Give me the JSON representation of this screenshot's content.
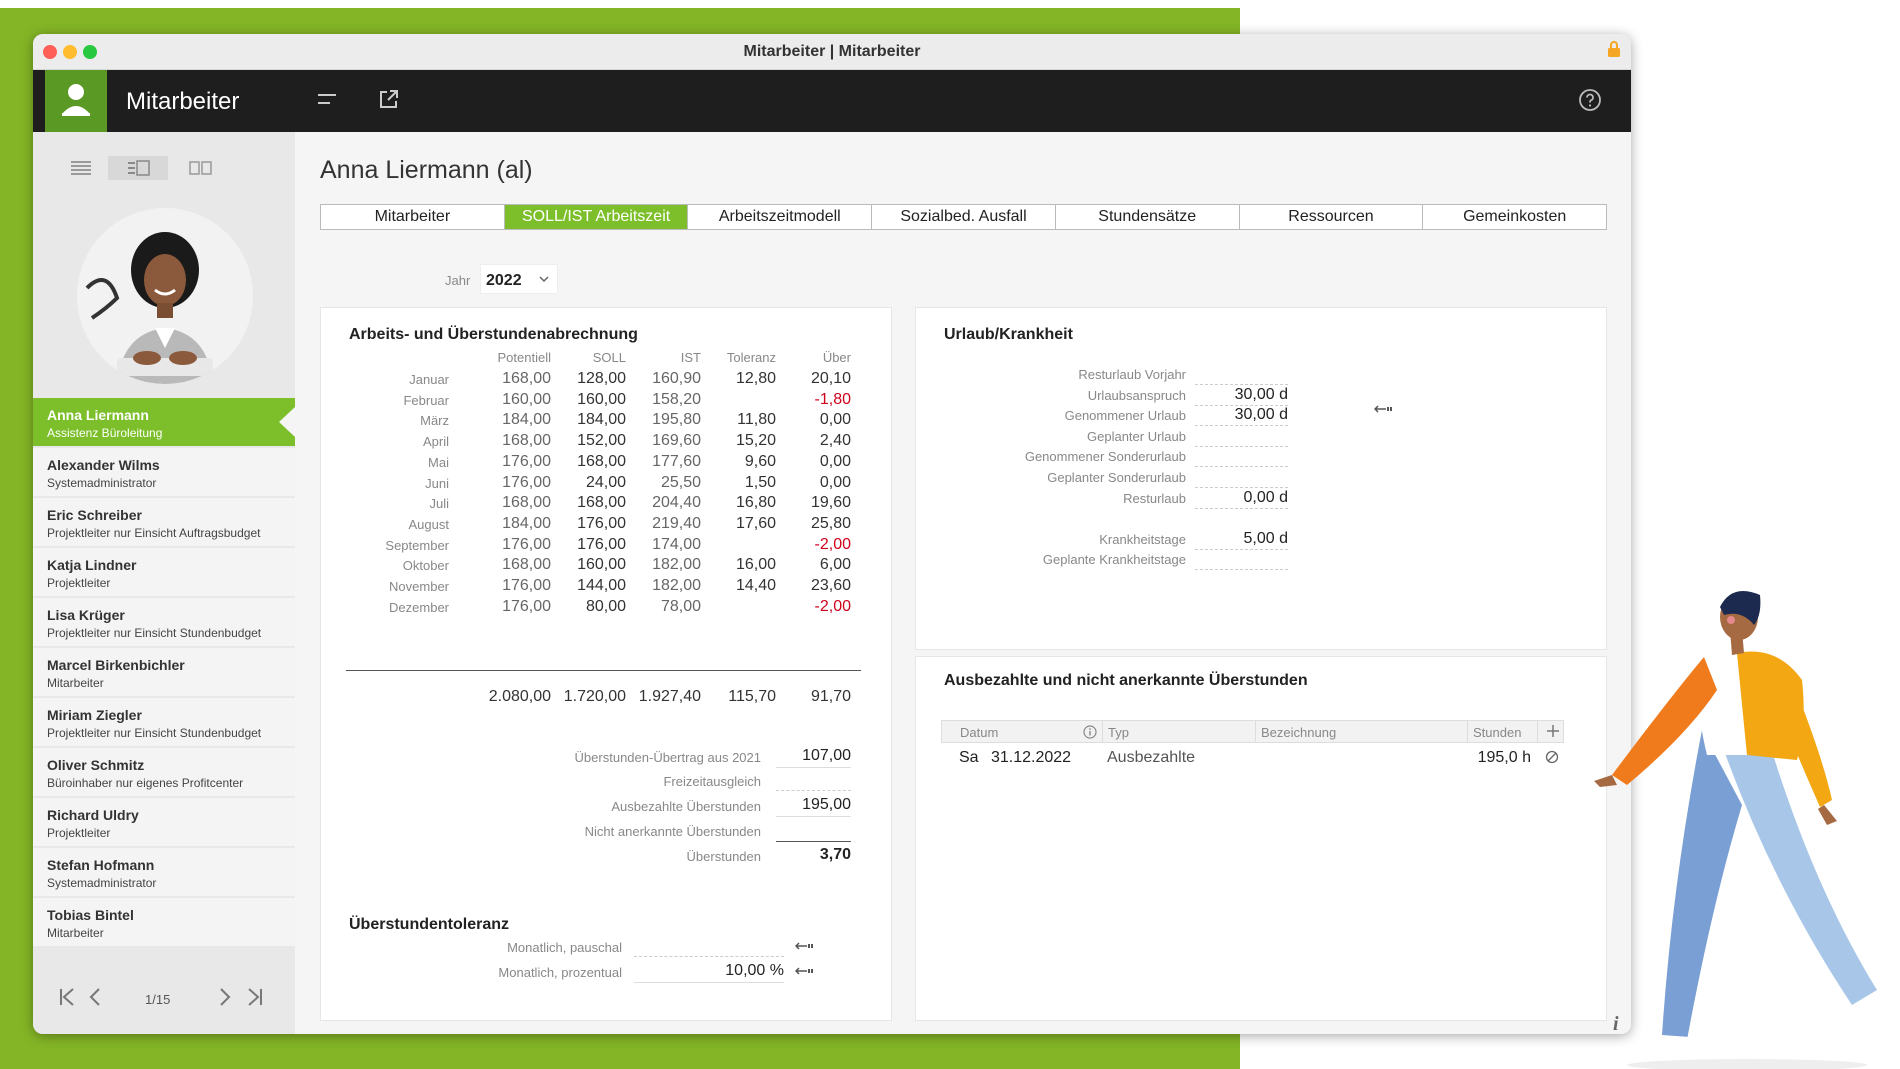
{
  "window": {
    "title": "Mitarbeiter | Mitarbeiter"
  },
  "app": {
    "name": "Mitarbeiter"
  },
  "sidebar": {
    "employees": [
      {
        "name": "Anna Liermann",
        "role": "Assistenz Büroleitung"
      },
      {
        "name": "Alexander Wilms",
        "role": "Systemadministrator"
      },
      {
        "name": "Eric Schreiber",
        "role": "Projektleiter nur Einsicht Auftragsbudget"
      },
      {
        "name": "Katja Lindner",
        "role": "Projektleiter"
      },
      {
        "name": "Lisa Krüger",
        "role": "Projektleiter nur Einsicht Stundenbudget"
      },
      {
        "name": "Marcel Birkenbichler",
        "role": "Mitarbeiter"
      },
      {
        "name": "Miriam Ziegler",
        "role": "Projektleiter nur Einsicht Stundenbudget"
      },
      {
        "name": "Oliver Schmitz",
        "role": "Büroinhaber nur eigenes Profitcenter"
      },
      {
        "name": "Richard Uldry",
        "role": "Projektleiter"
      },
      {
        "name": "Stefan Hofmann",
        "role": "Systemadministrator"
      },
      {
        "name": "Tobias Bintel",
        "role": "Mitarbeiter"
      }
    ],
    "pager": "1/15"
  },
  "main": {
    "title": "Anna Liermann (al)",
    "tabs": [
      "Mitarbeiter",
      "SOLL/IST Arbeitszeit",
      "Arbeitszeitmodell",
      "Sozialbed. Ausfall",
      "Stundensätze",
      "Ressourcen",
      "Gemeinkosten"
    ],
    "year_label": "Jahr",
    "year": "2022"
  },
  "hours": {
    "title": "Arbeits- und Überstundenabrechnung",
    "headers": [
      "Potentiell",
      "SOLL",
      "IST",
      "Toleranz",
      "Über"
    ],
    "rows": [
      {
        "month": "Januar",
        "pot": "168,00",
        "soll": "128,00",
        "ist": "160,90",
        "tol": "12,80",
        "uber": "20,10"
      },
      {
        "month": "Februar",
        "pot": "160,00",
        "soll": "160,00",
        "ist": "158,20",
        "tol": "",
        "uber": "-1,80"
      },
      {
        "month": "März",
        "pot": "184,00",
        "soll": "184,00",
        "ist": "195,80",
        "tol": "11,80",
        "uber": "0,00"
      },
      {
        "month": "April",
        "pot": "168,00",
        "soll": "152,00",
        "ist": "169,60",
        "tol": "15,20",
        "uber": "2,40"
      },
      {
        "month": "Mai",
        "pot": "176,00",
        "soll": "168,00",
        "ist": "177,60",
        "tol": "9,60",
        "uber": "0,00"
      },
      {
        "month": "Juni",
        "pot": "176,00",
        "soll": "24,00",
        "ist": "25,50",
        "tol": "1,50",
        "uber": "0,00"
      },
      {
        "month": "Juli",
        "pot": "168,00",
        "soll": "168,00",
        "ist": "204,40",
        "tol": "16,80",
        "uber": "19,60"
      },
      {
        "month": "August",
        "pot": "184,00",
        "soll": "176,00",
        "ist": "219,40",
        "tol": "17,60",
        "uber": "25,80"
      },
      {
        "month": "September",
        "pot": "176,00",
        "soll": "176,00",
        "ist": "174,00",
        "tol": "",
        "uber": "-2,00"
      },
      {
        "month": "Oktober",
        "pot": "168,00",
        "soll": "160,00",
        "ist": "182,00",
        "tol": "16,00",
        "uber": "6,00"
      },
      {
        "month": "November",
        "pot": "176,00",
        "soll": "144,00",
        "ist": "182,00",
        "tol": "14,40",
        "uber": "23,60"
      },
      {
        "month": "Dezember",
        "pot": "176,00",
        "soll": "80,00",
        "ist": "78,00",
        "tol": "",
        "uber": "-2,00"
      }
    ],
    "totals": {
      "pot": "2.080,00",
      "soll": "1.720,00",
      "ist": "1.927,40",
      "tol": "115,70",
      "uber": "91,70"
    },
    "summary": [
      {
        "label": "Überstunden-Übertrag aus 2021",
        "value": "107,00"
      },
      {
        "label": "Freizeitausgleich",
        "value": ""
      },
      {
        "label": "Ausbezahlte Überstunden",
        "value": "195,00"
      },
      {
        "label": "Nicht anerkannte Überstunden",
        "value": ""
      },
      {
        "label": "Überstunden",
        "value": "3,70"
      }
    ]
  },
  "tolerance": {
    "title": "Überstundentoleranz",
    "flat_label": "Monatlich, pauschal",
    "flat_value": "",
    "pct_label": "Monatlich, prozentual",
    "pct_value": "10,00 %"
  },
  "vacation": {
    "title": "Urlaub/Krankheit",
    "rows": [
      {
        "label": "Resturlaub Vorjahr",
        "value": ""
      },
      {
        "label": "Urlaubsanspruch",
        "value": "30,00 d"
      },
      {
        "label": "Genommener Urlaub",
        "value": "30,00 d"
      },
      {
        "label": "Geplanter Urlaub",
        "value": ""
      },
      {
        "label": "Genommener Sonderurlaub",
        "value": ""
      },
      {
        "label": "Geplanter Sonderurlaub",
        "value": ""
      },
      {
        "label": "Resturlaub",
        "value": "0,00 d"
      },
      {
        "label": "Krankheitstage",
        "value": "5,00 d"
      },
      {
        "label": "Geplante Krankheitstage",
        "value": ""
      }
    ]
  },
  "payout": {
    "title": "Ausbezahlte und nicht anerkannte Überstunden",
    "headers": [
      "Datum",
      "Typ",
      "Bezeichnung",
      "Stunden"
    ],
    "rows": [
      {
        "day": "Sa",
        "date": "31.12.2022",
        "type": "Ausbezahlte",
        "desc": "",
        "hours": "195,0 h"
      }
    ]
  },
  "colors": {
    "green_bg": "#84b526",
    "accent": "#7cbf2a",
    "negative": "#d0021b",
    "appbar": "#1e1e1e"
  }
}
